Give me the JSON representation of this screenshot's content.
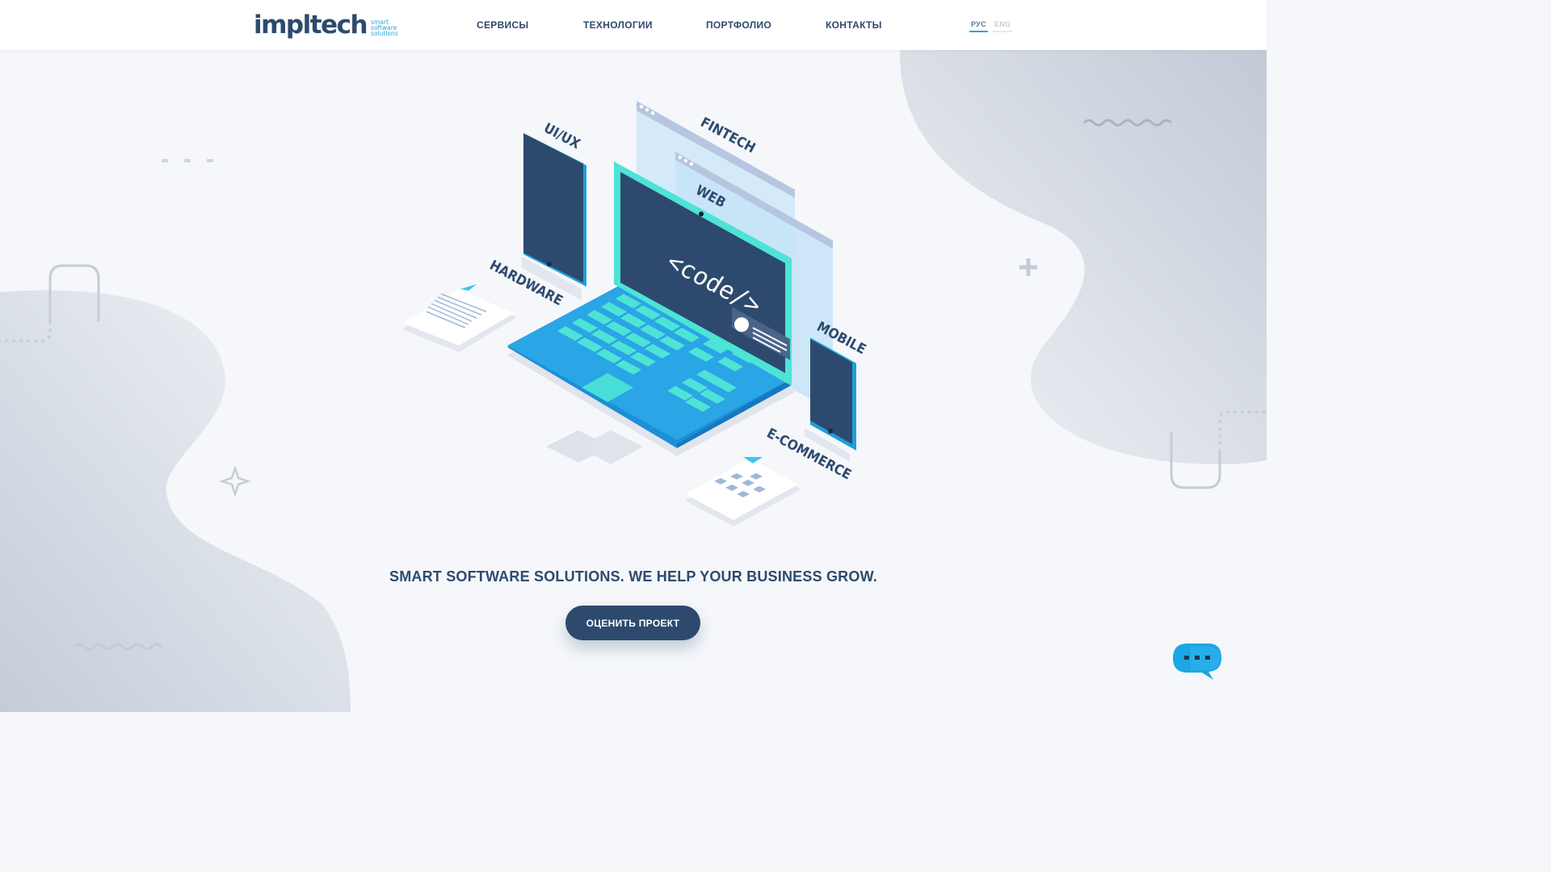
{
  "brand": {
    "name": "impltech",
    "tagline_lines": [
      "smart",
      "software",
      "solutions"
    ],
    "colors": {
      "primary": "#2d4a6e",
      "accent": "#2aa5e0",
      "teal": "#4de3d6"
    }
  },
  "nav": {
    "items": [
      {
        "label": "СЕРВИСЫ"
      },
      {
        "label": "ТЕХНОЛОГИИ"
      },
      {
        "label": "ПОРТФОЛИО"
      },
      {
        "label": "КОНТАКТЫ"
      }
    ]
  },
  "language": {
    "options": [
      "РУС",
      "ENG"
    ],
    "selected": "РУС"
  },
  "hero": {
    "screen_code": "<code/>",
    "labels": {
      "uiux": "UI/UX",
      "fintech": "FINTECH",
      "web": "WEB",
      "hardware": "HARDWARE",
      "mobile": "MOBILE",
      "ecommerce": "E-COMMERCE"
    },
    "tagline": "SMART SOFTWARE SOLUTIONS. WE HELP YOUR BUSINESS GROW.",
    "cta_label": "ОЦЕНИТЬ ПРОЕКТ"
  },
  "chat": {
    "icon": "chat-bubble-icon"
  }
}
